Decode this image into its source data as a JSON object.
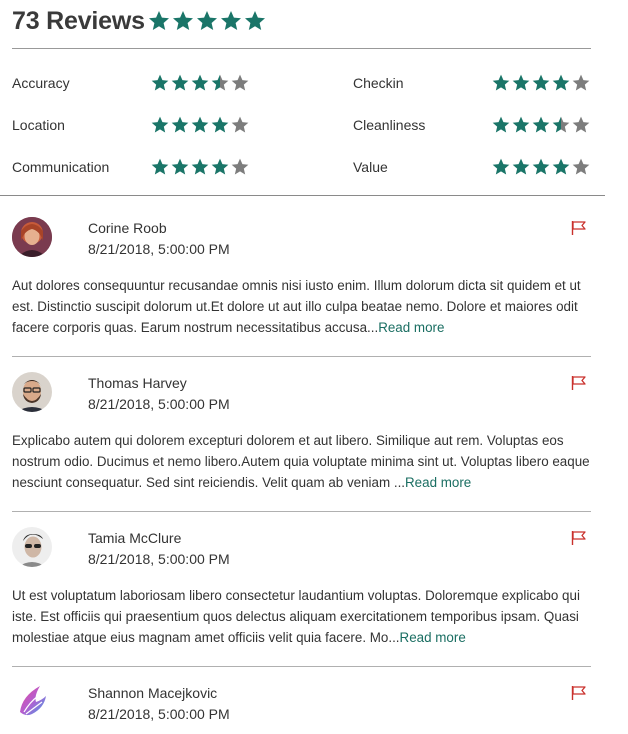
{
  "header": {
    "title": "73 Reviews",
    "overall_rating": 5,
    "star_color": "#1a7568"
  },
  "ratings": [
    {
      "label": "Accuracy",
      "value": 3.5
    },
    {
      "label": "Checkin",
      "value": 4
    },
    {
      "label": "Location",
      "value": 4
    },
    {
      "label": "Cleanliness",
      "value": 3.5
    },
    {
      "label": "Communication",
      "value": 4
    },
    {
      "label": "Value",
      "value": 4
    }
  ],
  "colors": {
    "star_filled": "#1a7568",
    "star_empty": "#7d7d7d",
    "flag": "#c9302c",
    "link": "#1a6e62"
  },
  "reviews": [
    {
      "name": "Corine Roob",
      "date": "8/21/2018, 5:00:00 PM",
      "text": "Aut dolores consequuntur recusandae omnis nisi iusto enim. Illum dolorum dicta sit quidem et ut est. Distinctio suscipit dolorum ut.Et dolore ut aut illo culpa beatae nemo. Dolore et maiores odit facere corporis quas. Earum nostrum necessitatibus accusa...",
      "read_more": "Read more",
      "avatar": "woman-portrait-avatar"
    },
    {
      "name": "Thomas Harvey",
      "date": "8/21/2018, 5:00:00 PM",
      "text": "Explicabo autem qui dolorem excepturi dolorem et aut libero. Similique aut rem. Voluptas eos nostrum odio. Ducimus et nemo libero.Autem quia voluptate minima sint ut. Voluptas libero eaque nesciunt consequatur. Sed sint reiciendis. Velit quam ab veniam ...",
      "read_more": "Read more",
      "avatar": "bearded-man-avatar"
    },
    {
      "name": "Tamia McClure",
      "date": "8/21/2018, 5:00:00 PM",
      "text": "Ut est voluptatum laboriosam libero consectetur laudantium voluptas. Doloremque explicabo qui iste. Est officiis qui praesentium quos delectus aliquam exercitationem temporibus ipsam. Quasi molestiae atque eius magnam amet officiis velit quia facere. Mo...",
      "read_more": "Read more",
      "avatar": "man-sunglasses-avatar"
    },
    {
      "name": "Shannon Macejkovic",
      "date": "8/21/2018, 5:00:00 PM",
      "text": "",
      "read_more": "",
      "avatar": "wing-logo-avatar"
    }
  ]
}
